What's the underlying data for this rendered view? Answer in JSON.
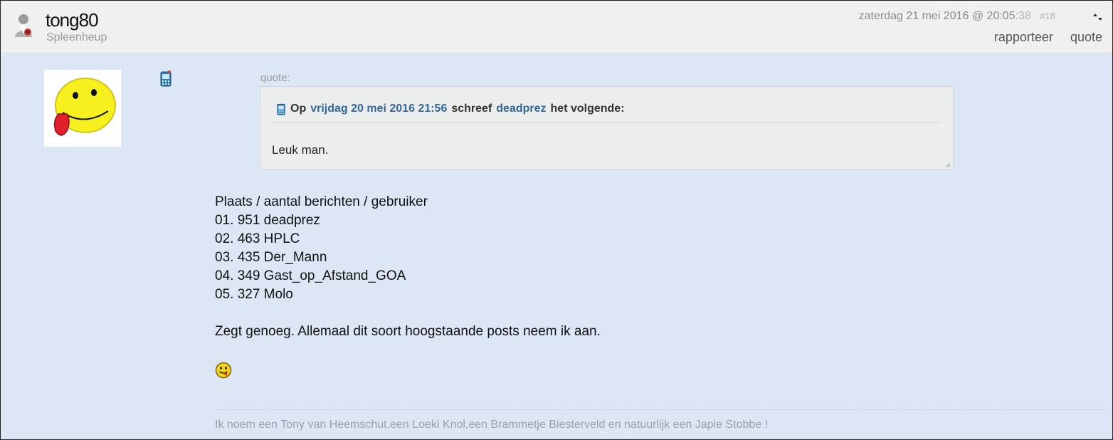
{
  "post": {
    "username": "tong80",
    "usertitle": "Spleenheup",
    "date_main": "zaterdag 21 mei 2016 @ 20:05",
    "date_seconds": ":38",
    "post_number": "#18",
    "actions": {
      "report": "rapporteer",
      "quote": "quote"
    }
  },
  "quote": {
    "label": "quote:",
    "prefix": "Op",
    "date": "vrijdag 20 mei 2016 21:56",
    "verb": "schreef",
    "author": "deadprez",
    "suffix": "het volgende:",
    "text": "Leuk man."
  },
  "body": {
    "lines": [
      "Plaats / aantal berichten / gebruiker",
      "01. 951 deadprez",
      "02. 463 HPLC",
      "03. 435 Der_Mann",
      "04. 349 Gast_op_Afstand_GOA",
      "05. 327 Molo"
    ],
    "closing": "Zegt genoeg. Allemaal dit soort hoogstaande posts neem ik aan."
  },
  "signature": "Ik noem een Tony van Heemschut,een Loeki Knol,een Brammetje Biesterveld en natuurlijk een Japie Stobbe !",
  "colors": {
    "post_bg": "#dce6f4",
    "header_bg": "#f0f0f0",
    "link": "#336699",
    "quote_bg": "#eceeee"
  },
  "icons": [
    "user-offline-icon",
    "sort-arrows-icon",
    "post-phone-icon",
    "quote-phone-icon",
    "tongue-smiley-icon"
  ]
}
